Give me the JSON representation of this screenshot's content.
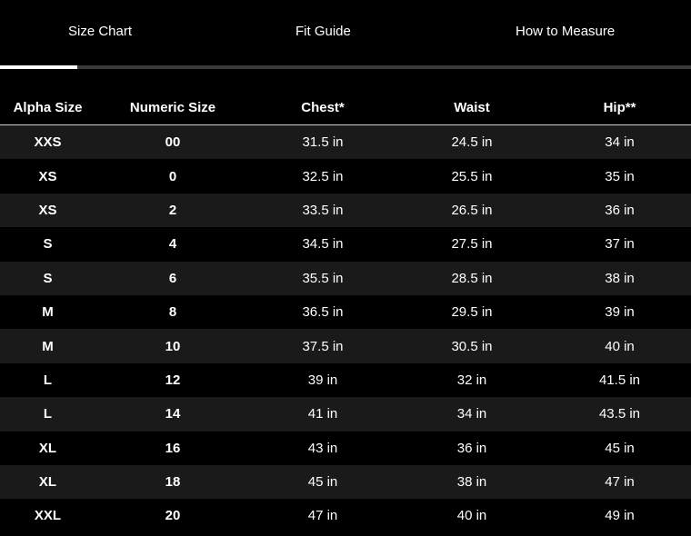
{
  "tabs": {
    "size_chart": "Size Chart",
    "fit_guide": "Fit Guide",
    "how_to_measure": "How to Measure",
    "active": "Size Chart"
  },
  "table": {
    "headers": {
      "alpha": "Alpha Size",
      "numeric": "Numeric Size",
      "chest": "Chest*",
      "waist": "Waist",
      "hip": "Hip**"
    },
    "rows": [
      {
        "alpha": "XXS",
        "numeric": "00",
        "chest": "31.5 in",
        "waist": "24.5 in",
        "hip": "34 in"
      },
      {
        "alpha": "XS",
        "numeric": "0",
        "chest": "32.5 in",
        "waist": "25.5 in",
        "hip": "35 in"
      },
      {
        "alpha": "XS",
        "numeric": "2",
        "chest": "33.5 in",
        "waist": "26.5 in",
        "hip": "36 in"
      },
      {
        "alpha": "S",
        "numeric": "4",
        "chest": "34.5 in",
        "waist": "27.5 in",
        "hip": "37 in"
      },
      {
        "alpha": "S",
        "numeric": "6",
        "chest": "35.5 in",
        "waist": "28.5 in",
        "hip": "38 in"
      },
      {
        "alpha": "M",
        "numeric": "8",
        "chest": "36.5 in",
        "waist": "29.5 in",
        "hip": "39 in"
      },
      {
        "alpha": "M",
        "numeric": "10",
        "chest": "37.5 in",
        "waist": "30.5 in",
        "hip": "40 in"
      },
      {
        "alpha": "L",
        "numeric": "12",
        "chest": "39 in",
        "waist": "32 in",
        "hip": "41.5 in"
      },
      {
        "alpha": "L",
        "numeric": "14",
        "chest": "41 in",
        "waist": "34 in",
        "hip": "43.5 in"
      },
      {
        "alpha": "XL",
        "numeric": "16",
        "chest": "43 in",
        "waist": "36 in",
        "hip": "45 in"
      },
      {
        "alpha": "XL",
        "numeric": "18",
        "chest": "45 in",
        "waist": "38 in",
        "hip": "47 in"
      },
      {
        "alpha": "XXL",
        "numeric": "20",
        "chest": "47 in",
        "waist": "40 in",
        "hip": "49 in"
      }
    ]
  },
  "colors": {
    "background": "#000000",
    "row_alt": "#1a1a1a",
    "text": "#ffffff",
    "tab_track": "#3a3a3a",
    "tab_indicator": "#ffffff"
  }
}
